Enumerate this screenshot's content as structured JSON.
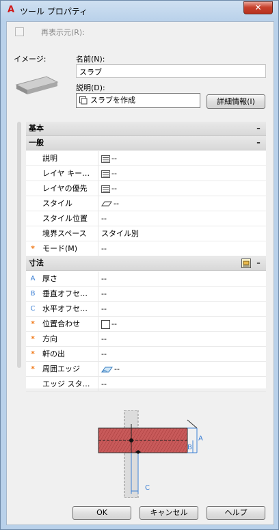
{
  "window": {
    "title": "ツール プロパティ",
    "app_icon": "A",
    "close_label": "✕"
  },
  "refresh": {
    "label": "再表示元(R):"
  },
  "image_label": "イメージ:",
  "name": {
    "label": "名前(N):",
    "value": "スラブ"
  },
  "description": {
    "label": "説明(D):",
    "value": "スラブを作成",
    "details_button": "詳細情報(I)"
  },
  "groups": {
    "basic": {
      "label": "基本"
    },
    "general": {
      "label": "一般"
    },
    "dimensions": {
      "label": "寸法"
    }
  },
  "general_props": [
    {
      "name": "説明",
      "value": "--",
      "icon": "list-icon"
    },
    {
      "name": "レイヤ キー…",
      "value": "--",
      "icon": "list-icon"
    },
    {
      "name": "レイヤの優先",
      "value": "--",
      "icon": "list-icon"
    },
    {
      "name": "スタイル",
      "value": "--",
      "icon": "slab-style-icon"
    },
    {
      "name": "スタイル位置",
      "value": "--",
      "icon": ""
    },
    {
      "name": "境界スペース",
      "value": "スタイル別",
      "icon": ""
    },
    {
      "name": "モード(M)",
      "value": "--",
      "icon": "",
      "marker": "*"
    }
  ],
  "dimension_props": [
    {
      "name": "厚さ",
      "value": "--",
      "marker": "A"
    },
    {
      "name": "垂直オフセ…",
      "value": "--",
      "marker": "B"
    },
    {
      "name": "水平オフセ…",
      "value": "--",
      "marker": "C"
    },
    {
      "name": "位置合わせ",
      "value": "--",
      "marker": "*",
      "icon": "checkbox-icon"
    },
    {
      "name": "方向",
      "value": "--",
      "marker": "*"
    },
    {
      "name": "軒の出",
      "value": "--",
      "marker": "*"
    },
    {
      "name": "周囲エッジ",
      "value": "--",
      "marker": "*",
      "icon": "edge-icon"
    },
    {
      "name": "エッジ スタ…",
      "value": "--",
      "marker": ""
    }
  ],
  "diagram": {
    "label_a": "A",
    "label_b": "B",
    "label_c": "C"
  },
  "buttons": {
    "ok": "OK",
    "cancel": "キャンセル",
    "help": "ヘルプ"
  },
  "colors": {
    "accent_star": "#f07a1a",
    "letter_marker": "#3b7fd4",
    "slab_fill": "#c85a5a"
  }
}
